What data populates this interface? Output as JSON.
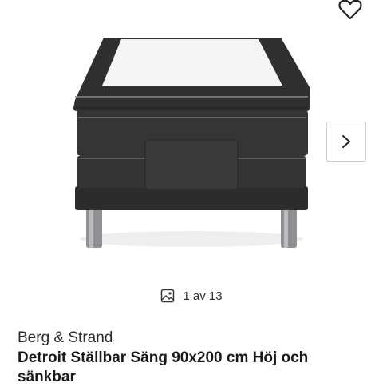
{
  "gallery": {
    "image_alt": "Detroit Ställbar Säng 90x200 cm Höj och sänkbar",
    "favorite_icon": "heart-outline-icon",
    "next_icon": "chevron-right-icon",
    "counter_icon": "image-gallery-icon",
    "counter_text": "1 av 13"
  },
  "product": {
    "brand": "Berg & Strand",
    "title": "Detroit Ställbar Säng 90x200 cm Höj och sänkbar"
  }
}
